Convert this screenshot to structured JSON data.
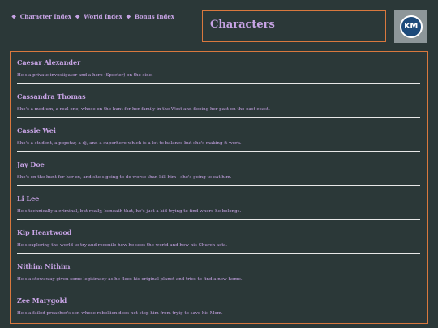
{
  "nav": {
    "bullet": "❖",
    "links": [
      "Character Index",
      "World Index",
      "Bonus Index"
    ]
  },
  "header": {
    "title": "Characters"
  },
  "avatar": {
    "initials": "KM"
  },
  "characters": [
    {
      "name": "Caesar Alexander",
      "desc": "He's a private investigator and a hero (Specter) on the side."
    },
    {
      "name": "Cassandra Thomas",
      "desc": "She's a medium, a real one, whose on the hunt for her family in the West and fleeing her past on the east coast."
    },
    {
      "name": "Cassie Wei",
      "desc": "She's a student, a popstar, a dj, and a superhero which is a lot to balance but she's making it work."
    },
    {
      "name": "Jay Doe",
      "desc": "She's on the hunt for her ex, and she's going to do worse than kill him - she's going to eat him."
    },
    {
      "name": "Li Lee",
      "desc": "He's technically a criminal, but really, beneath that, he's just a kid trying to find where he belongs."
    },
    {
      "name": "Kip Heartwood",
      "desc": "He's exploring the world to try and reconile how he sees the world and how his Church acts."
    },
    {
      "name": "Nithim Nithim",
      "desc": "He's a stowaway given some legitimacy as he flees his original planet and tries to find a new home."
    },
    {
      "name": "Zee Marygold",
      "desc": "He's a failed preacher's son whose rebellion does not stop him from tryig to save his Mom."
    }
  ],
  "colors": {
    "background": "#2b3838",
    "accent_border": "#d9783e",
    "text": "#c8a4e6",
    "divider": "#e8e8e8"
  }
}
